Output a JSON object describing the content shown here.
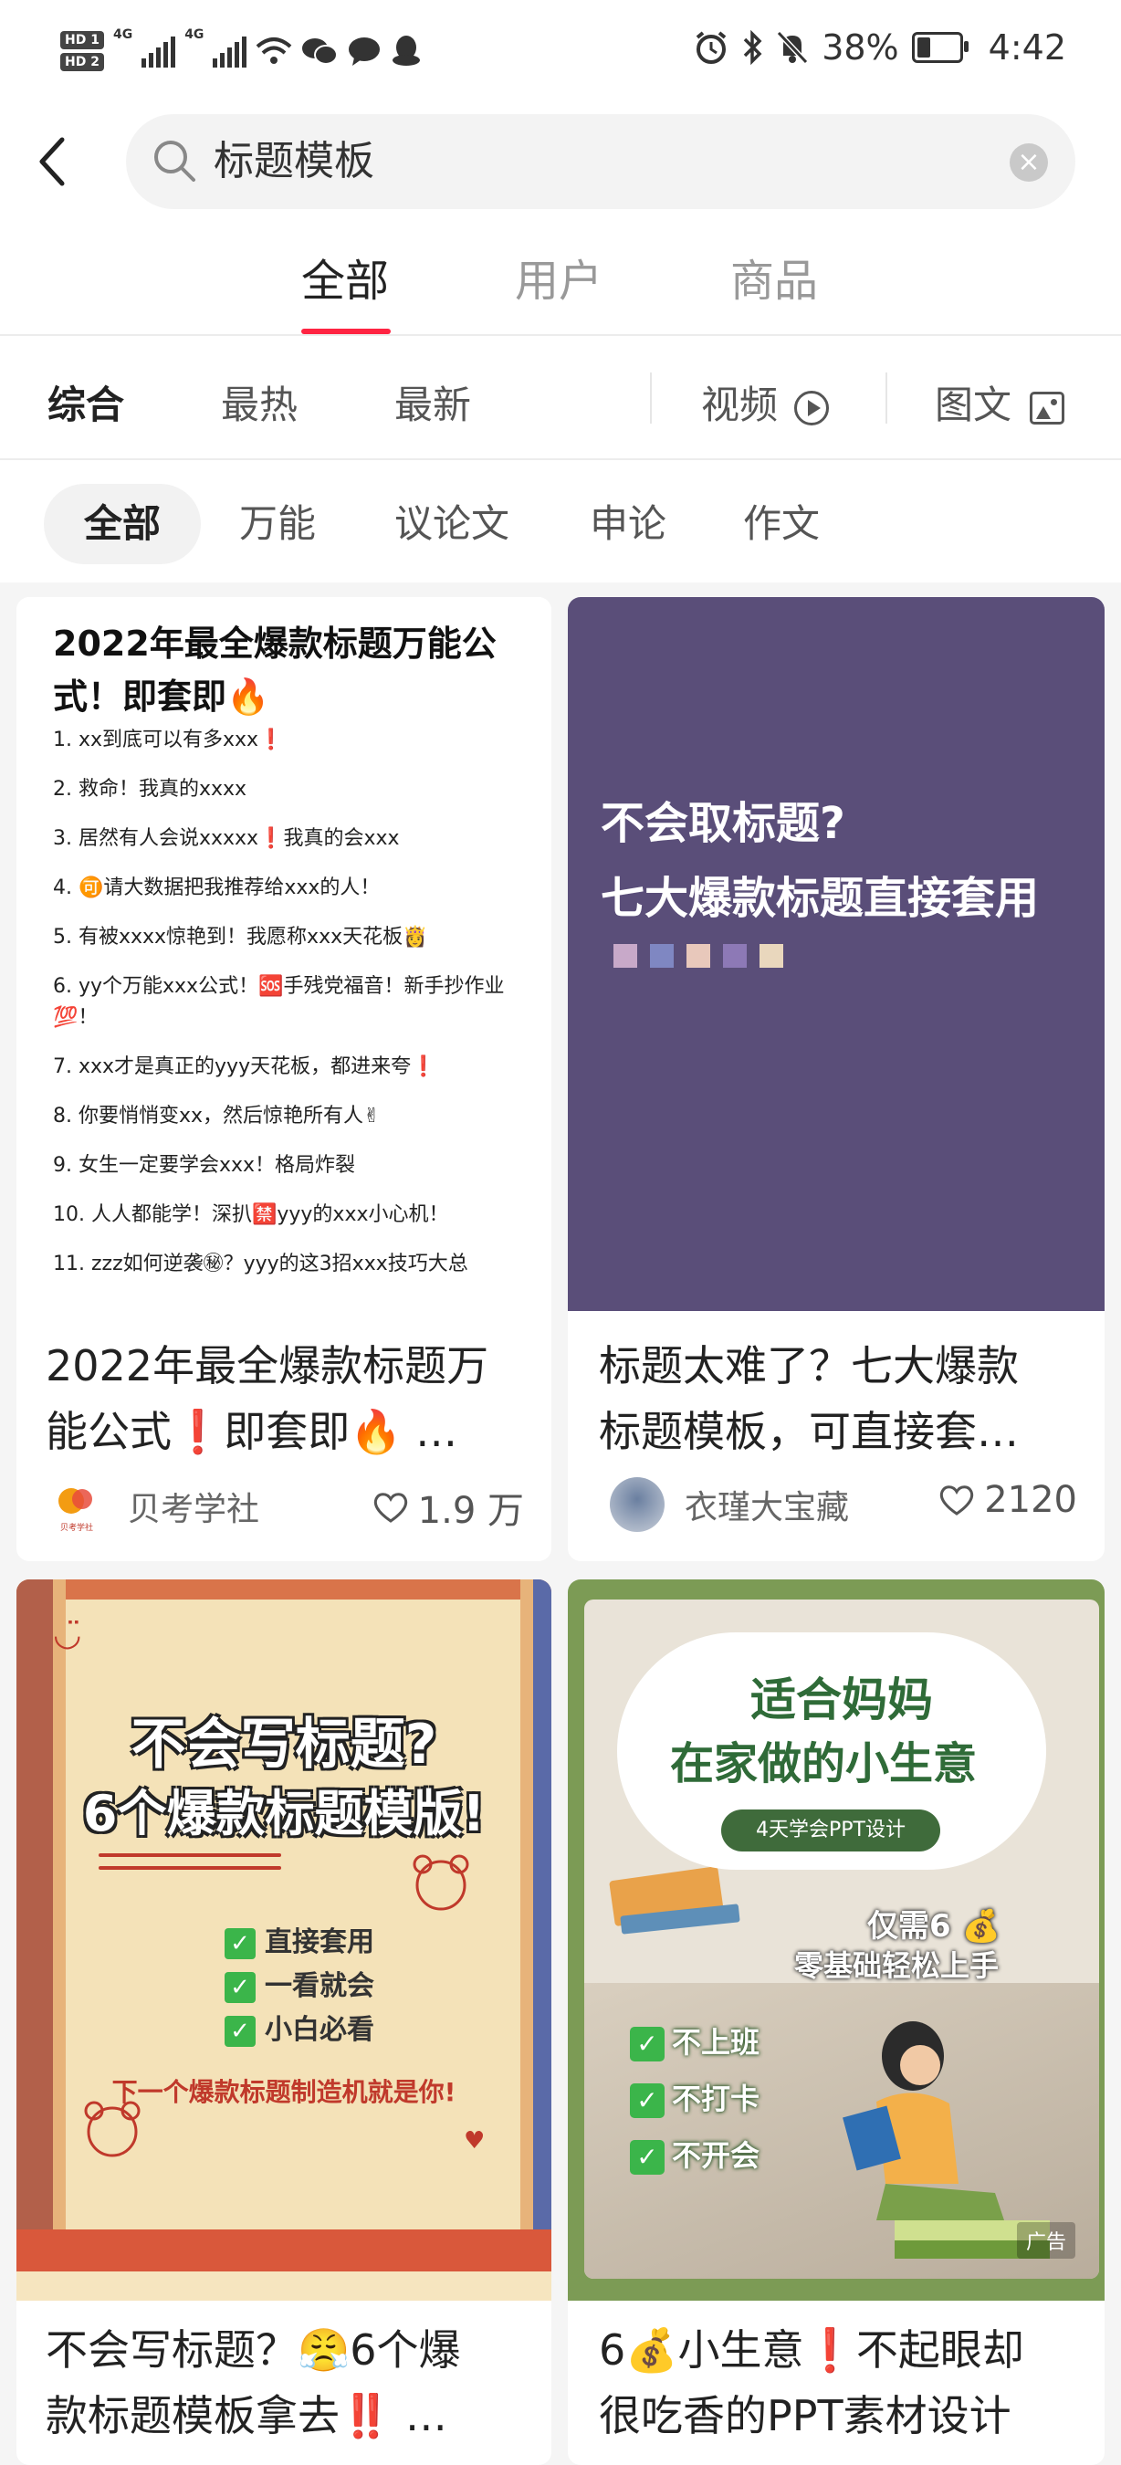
{
  "status_bar": {
    "hd1": "HD 1",
    "hd2": "HD 2",
    "net1": "4G",
    "net2": "4G",
    "battery_pct": "38%",
    "time": "4:42"
  },
  "search": {
    "query": "标题模板"
  },
  "main_tabs": [
    {
      "label": "全部",
      "active": true
    },
    {
      "label": "用户",
      "active": false
    },
    {
      "label": "商品",
      "active": false
    }
  ],
  "sort_filters": {
    "comprehensive": "综合",
    "hottest": "最热",
    "newest": "最新",
    "video": "视频",
    "image_text": "图文"
  },
  "chips": [
    "全部",
    "万能",
    "议论文",
    "申论",
    "作文"
  ],
  "accent_color": "#ff2442",
  "cards": [
    {
      "cover": {
        "heading": "2022年最全爆款标题万能公式！即套即🔥",
        "items": [
          "1. xx到底可以有多xxx❗",
          "2. 救命！我真的xxxx",
          "3. 居然有人会说xxxxx❗我真的会xxx",
          "4. 🉑请大数据把我推荐给xxx的人！",
          "5. 有被xxxx惊艳到！我愿称xxx天花板👸",
          "6. yy个万能xxx公式！🆘手残党福音！新手抄作业💯！",
          "7. xxx才是真正的yyy天花板，都进来夸❗",
          "8. 你要悄悄变xx，然后惊艳所有人✌",
          "9. 女生一定要学会xxx！格局炸裂",
          "10. 人人都能学！深扒🈲yyy的xxx小心机！",
          "11. zzz如何逆袭㊙？yyy的这3招xxx技巧大总"
        ]
      },
      "title_line1": "2022年最全爆款标题万",
      "title_line2": "能公式❗即套即🔥 …",
      "author": "贝考学社",
      "avatar_caption": "贝考学社",
      "likes": "1.9 万"
    },
    {
      "cover": {
        "line1": "不会取标题?",
        "line2": "七大爆款标题直接套用",
        "bg_color": "#5a4e79"
      },
      "title_line1": "标题太难了？七大爆款",
      "title_line2": "标题模板，可直接套…",
      "author": "衣瑾大宝藏",
      "likes": "2120"
    },
    {
      "cover": {
        "line1": "不会写标题?",
        "line2": "6个爆款标题模版!",
        "checks": [
          "直接套用",
          "一看就会",
          "小白必看"
        ],
        "slogan": "下一个爆款标题制造机就是你!"
      },
      "title_line1": "不会写标题？😤6个爆",
      "title_line2": "款标题模板拿去‼️ …"
    },
    {
      "cover": {
        "line1": "适合妈妈",
        "line2": "在家做的小生意",
        "pill": "4天学会PPT设计",
        "note1": "仅需6 💰",
        "note2": "零基础轻松上手",
        "checks": [
          "不上班",
          "不打卡",
          "不开会"
        ],
        "ad_label": "广告"
      },
      "title_line1": "6💰小生意❗不起眼却",
      "title_line2": "很吃香的PPT素材设计"
    }
  ]
}
